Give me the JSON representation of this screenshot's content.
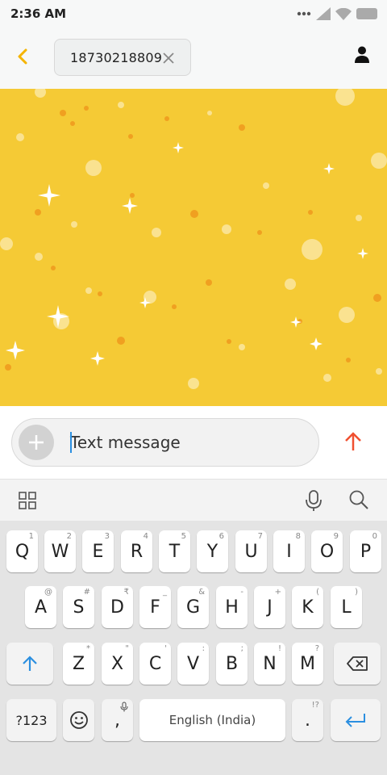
{
  "status_bar": {
    "time": "2:36 AM"
  },
  "header": {
    "recipient": "18730218809"
  },
  "compose": {
    "placeholder": "Text message"
  },
  "keyboard": {
    "row1": [
      {
        "label": "Q",
        "hint": "1"
      },
      {
        "label": "W",
        "hint": "2"
      },
      {
        "label": "E",
        "hint": "3"
      },
      {
        "label": "R",
        "hint": "4"
      },
      {
        "label": "T",
        "hint": "5"
      },
      {
        "label": "Y",
        "hint": "6"
      },
      {
        "label": "U",
        "hint": "7"
      },
      {
        "label": "I",
        "hint": "8"
      },
      {
        "label": "O",
        "hint": "9"
      },
      {
        "label": "P",
        "hint": "0"
      }
    ],
    "row2": [
      {
        "label": "A",
        "hint": "@"
      },
      {
        "label": "S",
        "hint": "#"
      },
      {
        "label": "D",
        "hint": "₹"
      },
      {
        "label": "F",
        "hint": "_"
      },
      {
        "label": "G",
        "hint": "&"
      },
      {
        "label": "H",
        "hint": "-"
      },
      {
        "label": "J",
        "hint": "+"
      },
      {
        "label": "K",
        "hint": "("
      },
      {
        "label": "L",
        "hint": ")"
      }
    ],
    "row3": [
      {
        "label": "Z",
        "hint": "*"
      },
      {
        "label": "X",
        "hint": "\""
      },
      {
        "label": "C",
        "hint": "'"
      },
      {
        "label": "V",
        "hint": ":"
      },
      {
        "label": "B",
        "hint": ";"
      },
      {
        "label": "N",
        "hint": "!"
      },
      {
        "label": "M",
        "hint": "?"
      }
    ],
    "symbols_label": "?123",
    "comma_label": ",",
    "space_label": "English (India)",
    "period_label": ".",
    "period_hint": "!?"
  },
  "colors": {
    "accent": "#f5b400",
    "wallpaper": "#f5ca35",
    "send": "#f05030",
    "cursor": "#2b8fe0"
  },
  "icons": {
    "back": "chevron-left-icon",
    "chip_close": "close-icon",
    "contact": "person-icon",
    "attach": "plus-icon",
    "send": "arrow-up-icon",
    "toolbar_left": "grid-icon",
    "toolbar_mic": "microphone-icon",
    "toolbar_search": "search-icon",
    "shift": "shift-icon",
    "backspace": "backspace-icon",
    "emoji": "emoji-icon",
    "enter": "enter-icon"
  }
}
